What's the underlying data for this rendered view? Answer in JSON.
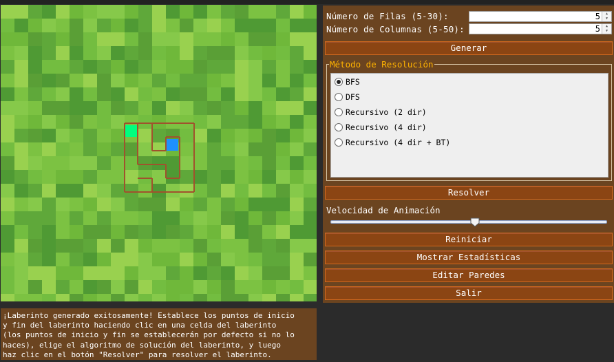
{
  "filas": {
    "label": "Número de Filas (5-30):",
    "value": "5"
  },
  "columnas": {
    "label": "Número de Columnas (5-50):",
    "value": "5"
  },
  "buttons": {
    "generar": "Generar",
    "resolver": "Resolver",
    "reiniciar": "Reiniciar",
    "estadisticas": "Mostrar Estadísticas",
    "editar": "Editar Paredes",
    "salir": "Salir"
  },
  "metodo": {
    "title": "Método de Resolución",
    "options": [
      "BFS",
      "DFS",
      "Recursivo (2 dir)",
      "Recursivo (4 dir)",
      "Recursivo (4 dir + BT)"
    ],
    "selected": "BFS"
  },
  "velocidad": {
    "label": "Velocidad de Animación",
    "level": 0.54
  },
  "message": "¡Laberinto generado exitosamente! Establece los puntos de inicio\ny fin del laberinto haciendo clic en una celda del laberinto\n(los puntos de inicio y fin se establecerán por defecto si no lo\nhaces), elige el algoritmo de solución del laberinto, y luego\nhaz clic en el botón \"Resolver\" para resolver el laberinto.",
  "colors": {
    "panel": "#6b4420",
    "button": "#8b4513",
    "legend": "#ffb300",
    "wall": "#a0522d",
    "start": "#00ff7f",
    "end": "#1e90ff"
  },
  "maze": {
    "rows": 5,
    "cols": 5
  }
}
